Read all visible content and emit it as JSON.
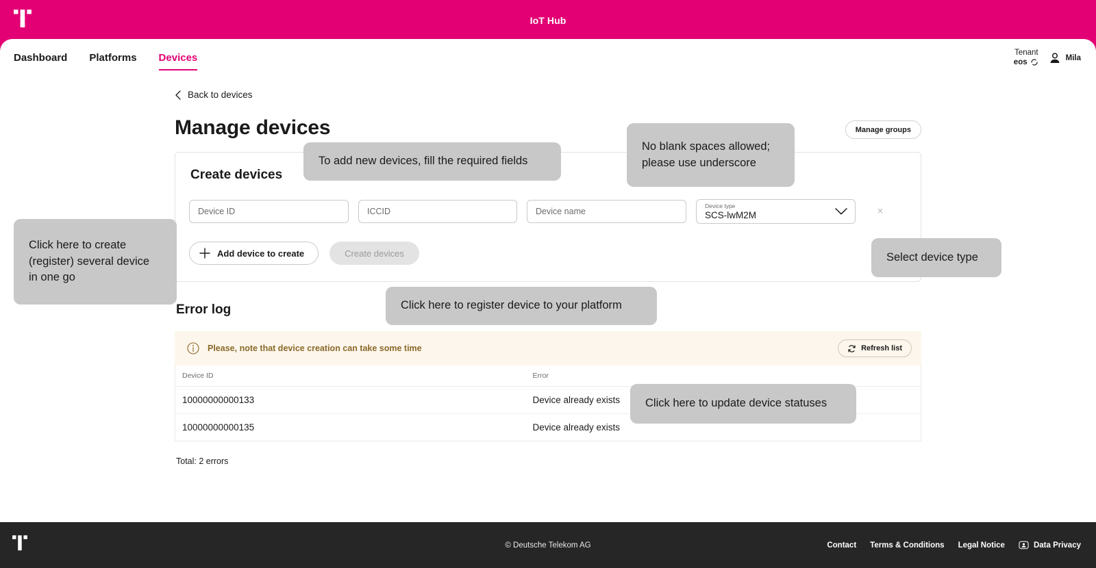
{
  "topbar": {
    "title": "IoT Hub",
    "logo": "telekom-t-logo"
  },
  "nav": {
    "items": [
      {
        "label": "Dashboard",
        "active": false
      },
      {
        "label": "Platforms",
        "active": false
      },
      {
        "label": "Devices",
        "active": true
      }
    ],
    "tenant_label": "Tenant",
    "tenant_value": "eos",
    "user_name": "Mila"
  },
  "page": {
    "back_label": "Back to devices",
    "title": "Manage devices",
    "manage_groups_label": "Manage groups"
  },
  "create_card": {
    "title": "Create devices",
    "fields": {
      "device_id_placeholder": "Device ID",
      "device_id_value": "",
      "iccid_placeholder": "ICCID",
      "iccid_value": "",
      "device_name_placeholder": "Device name",
      "device_name_value": "",
      "device_type_label": "Device type",
      "device_type_value": "SCS-lwM2M"
    },
    "remove_row_label": "×",
    "add_device_label": "Add device to create",
    "create_devices_label": "Create devices"
  },
  "error_log": {
    "title": "Error log",
    "notice_text": "Please, note that device creation can take some time",
    "refresh_label": "Refresh list",
    "columns": [
      "Device ID",
      "Error"
    ],
    "rows": [
      {
        "device_id": "10000000000133",
        "error": "Device already exists"
      },
      {
        "device_id": "10000000000135",
        "error": "Device already exists"
      }
    ],
    "total": "Total: 2 errors"
  },
  "callouts": [
    {
      "text": "To add new devices, fill the required fields"
    },
    {
      "text": "No blank spaces allowed;\nplease use underscore"
    },
    {
      "text": "Click here to create\n(register) several device\nin one go"
    },
    {
      "text": "Select device type"
    },
    {
      "text": "Click here to register device to your platform"
    },
    {
      "text": "Click here to update device statuses"
    }
  ],
  "footer": {
    "copyright": "© Deutsche Telekom AG",
    "links": [
      "Contact",
      "Terms & Conditions",
      "Legal Notice"
    ],
    "privacy_label": "Data Privacy"
  },
  "colors": {
    "magenta": "#e20074",
    "footer_bg": "#262626",
    "callout_bg": "#c8c8c8",
    "notice_bg": "#fdf6ec",
    "notice_text": "#8a6a2a"
  }
}
